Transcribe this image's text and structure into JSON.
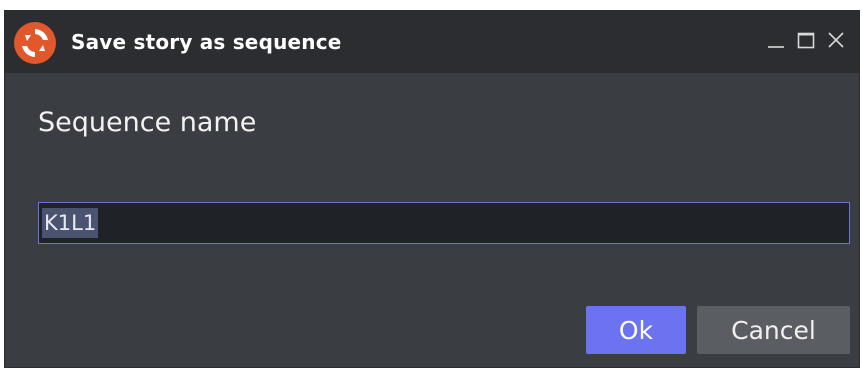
{
  "dialog": {
    "title": "Save story as sequence",
    "logo_icon": "app-logo-icon",
    "controls": {
      "minimize_icon": "minimize-icon",
      "maximize_icon": "maximize-icon",
      "close_icon": "close-icon"
    }
  },
  "form": {
    "label": "Sequence name",
    "value": "K1L1"
  },
  "buttons": {
    "ok_label": "Ok",
    "cancel_label": "Cancel"
  },
  "colors": {
    "accent": "#6b73f0",
    "window_bg": "#3a3d42",
    "titlebar_bg": "#2b2d31",
    "input_border": "#6a74d8",
    "logo_orange": "#e0582c"
  }
}
